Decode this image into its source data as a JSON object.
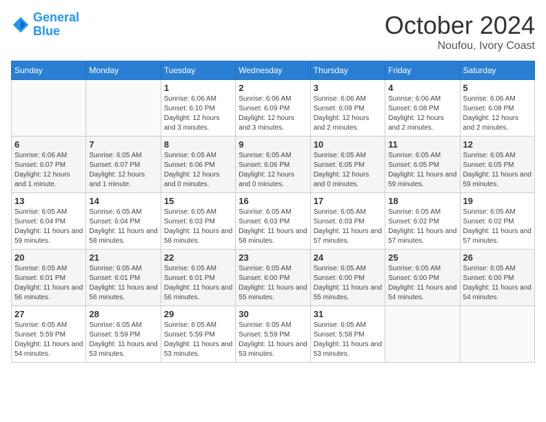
{
  "header": {
    "logo_line1": "General",
    "logo_line2": "Blue",
    "month": "October 2024",
    "location": "Noufou, Ivory Coast"
  },
  "weekdays": [
    "Sunday",
    "Monday",
    "Tuesday",
    "Wednesday",
    "Thursday",
    "Friday",
    "Saturday"
  ],
  "weeks": [
    [
      {
        "day": "",
        "info": ""
      },
      {
        "day": "",
        "info": ""
      },
      {
        "day": "1",
        "info": "Sunrise: 6:06 AM\nSunset: 6:10 PM\nDaylight: 12 hours and 3 minutes."
      },
      {
        "day": "2",
        "info": "Sunrise: 6:06 AM\nSunset: 6:09 PM\nDaylight: 12 hours and 3 minutes."
      },
      {
        "day": "3",
        "info": "Sunrise: 6:06 AM\nSunset: 6:09 PM\nDaylight: 12 hours and 2 minutes."
      },
      {
        "day": "4",
        "info": "Sunrise: 6:06 AM\nSunset: 6:08 PM\nDaylight: 12 hours and 2 minutes."
      },
      {
        "day": "5",
        "info": "Sunrise: 6:06 AM\nSunset: 6:08 PM\nDaylight: 12 hours and 2 minutes."
      }
    ],
    [
      {
        "day": "6",
        "info": "Sunrise: 6:06 AM\nSunset: 6:07 PM\nDaylight: 12 hours and 1 minute."
      },
      {
        "day": "7",
        "info": "Sunrise: 6:05 AM\nSunset: 6:07 PM\nDaylight: 12 hours and 1 minute."
      },
      {
        "day": "8",
        "info": "Sunrise: 6:05 AM\nSunset: 6:06 PM\nDaylight: 12 hours and 0 minutes."
      },
      {
        "day": "9",
        "info": "Sunrise: 6:05 AM\nSunset: 6:06 PM\nDaylight: 12 hours and 0 minutes."
      },
      {
        "day": "10",
        "info": "Sunrise: 6:05 AM\nSunset: 6:05 PM\nDaylight: 12 hours and 0 minutes."
      },
      {
        "day": "11",
        "info": "Sunrise: 6:05 AM\nSunset: 6:05 PM\nDaylight: 11 hours and 59 minutes."
      },
      {
        "day": "12",
        "info": "Sunrise: 6:05 AM\nSunset: 6:05 PM\nDaylight: 11 hours and 59 minutes."
      }
    ],
    [
      {
        "day": "13",
        "info": "Sunrise: 6:05 AM\nSunset: 6:04 PM\nDaylight: 11 hours and 59 minutes."
      },
      {
        "day": "14",
        "info": "Sunrise: 6:05 AM\nSunset: 6:04 PM\nDaylight: 11 hours and 58 minutes."
      },
      {
        "day": "15",
        "info": "Sunrise: 6:05 AM\nSunset: 6:03 PM\nDaylight: 11 hours and 58 minutes."
      },
      {
        "day": "16",
        "info": "Sunrise: 6:05 AM\nSunset: 6:03 PM\nDaylight: 11 hours and 58 minutes."
      },
      {
        "day": "17",
        "info": "Sunrise: 6:05 AM\nSunset: 6:03 PM\nDaylight: 11 hours and 57 minutes."
      },
      {
        "day": "18",
        "info": "Sunrise: 6:05 AM\nSunset: 6:02 PM\nDaylight: 11 hours and 57 minutes."
      },
      {
        "day": "19",
        "info": "Sunrise: 6:05 AM\nSunset: 6:02 PM\nDaylight: 11 hours and 57 minutes."
      }
    ],
    [
      {
        "day": "20",
        "info": "Sunrise: 6:05 AM\nSunset: 6:01 PM\nDaylight: 11 hours and 56 minutes."
      },
      {
        "day": "21",
        "info": "Sunrise: 6:05 AM\nSunset: 6:01 PM\nDaylight: 11 hours and 56 minutes."
      },
      {
        "day": "22",
        "info": "Sunrise: 6:05 AM\nSunset: 6:01 PM\nDaylight: 11 hours and 56 minutes."
      },
      {
        "day": "23",
        "info": "Sunrise: 6:05 AM\nSunset: 6:00 PM\nDaylight: 11 hours and 55 minutes."
      },
      {
        "day": "24",
        "info": "Sunrise: 6:05 AM\nSunset: 6:00 PM\nDaylight: 11 hours and 55 minutes."
      },
      {
        "day": "25",
        "info": "Sunrise: 6:05 AM\nSunset: 6:00 PM\nDaylight: 11 hours and 54 minutes."
      },
      {
        "day": "26",
        "info": "Sunrise: 6:05 AM\nSunset: 6:00 PM\nDaylight: 11 hours and 54 minutes."
      }
    ],
    [
      {
        "day": "27",
        "info": "Sunrise: 6:05 AM\nSunset: 5:59 PM\nDaylight: 11 hours and 54 minutes."
      },
      {
        "day": "28",
        "info": "Sunrise: 6:05 AM\nSunset: 5:59 PM\nDaylight: 11 hours and 53 minutes."
      },
      {
        "day": "29",
        "info": "Sunrise: 6:05 AM\nSunset: 5:59 PM\nDaylight: 11 hours and 53 minutes."
      },
      {
        "day": "30",
        "info": "Sunrise: 6:05 AM\nSunset: 5:59 PM\nDaylight: 11 hours and 53 minutes."
      },
      {
        "day": "31",
        "info": "Sunrise: 6:05 AM\nSunset: 5:58 PM\nDaylight: 11 hours and 53 minutes."
      },
      {
        "day": "",
        "info": ""
      },
      {
        "day": "",
        "info": ""
      }
    ]
  ]
}
